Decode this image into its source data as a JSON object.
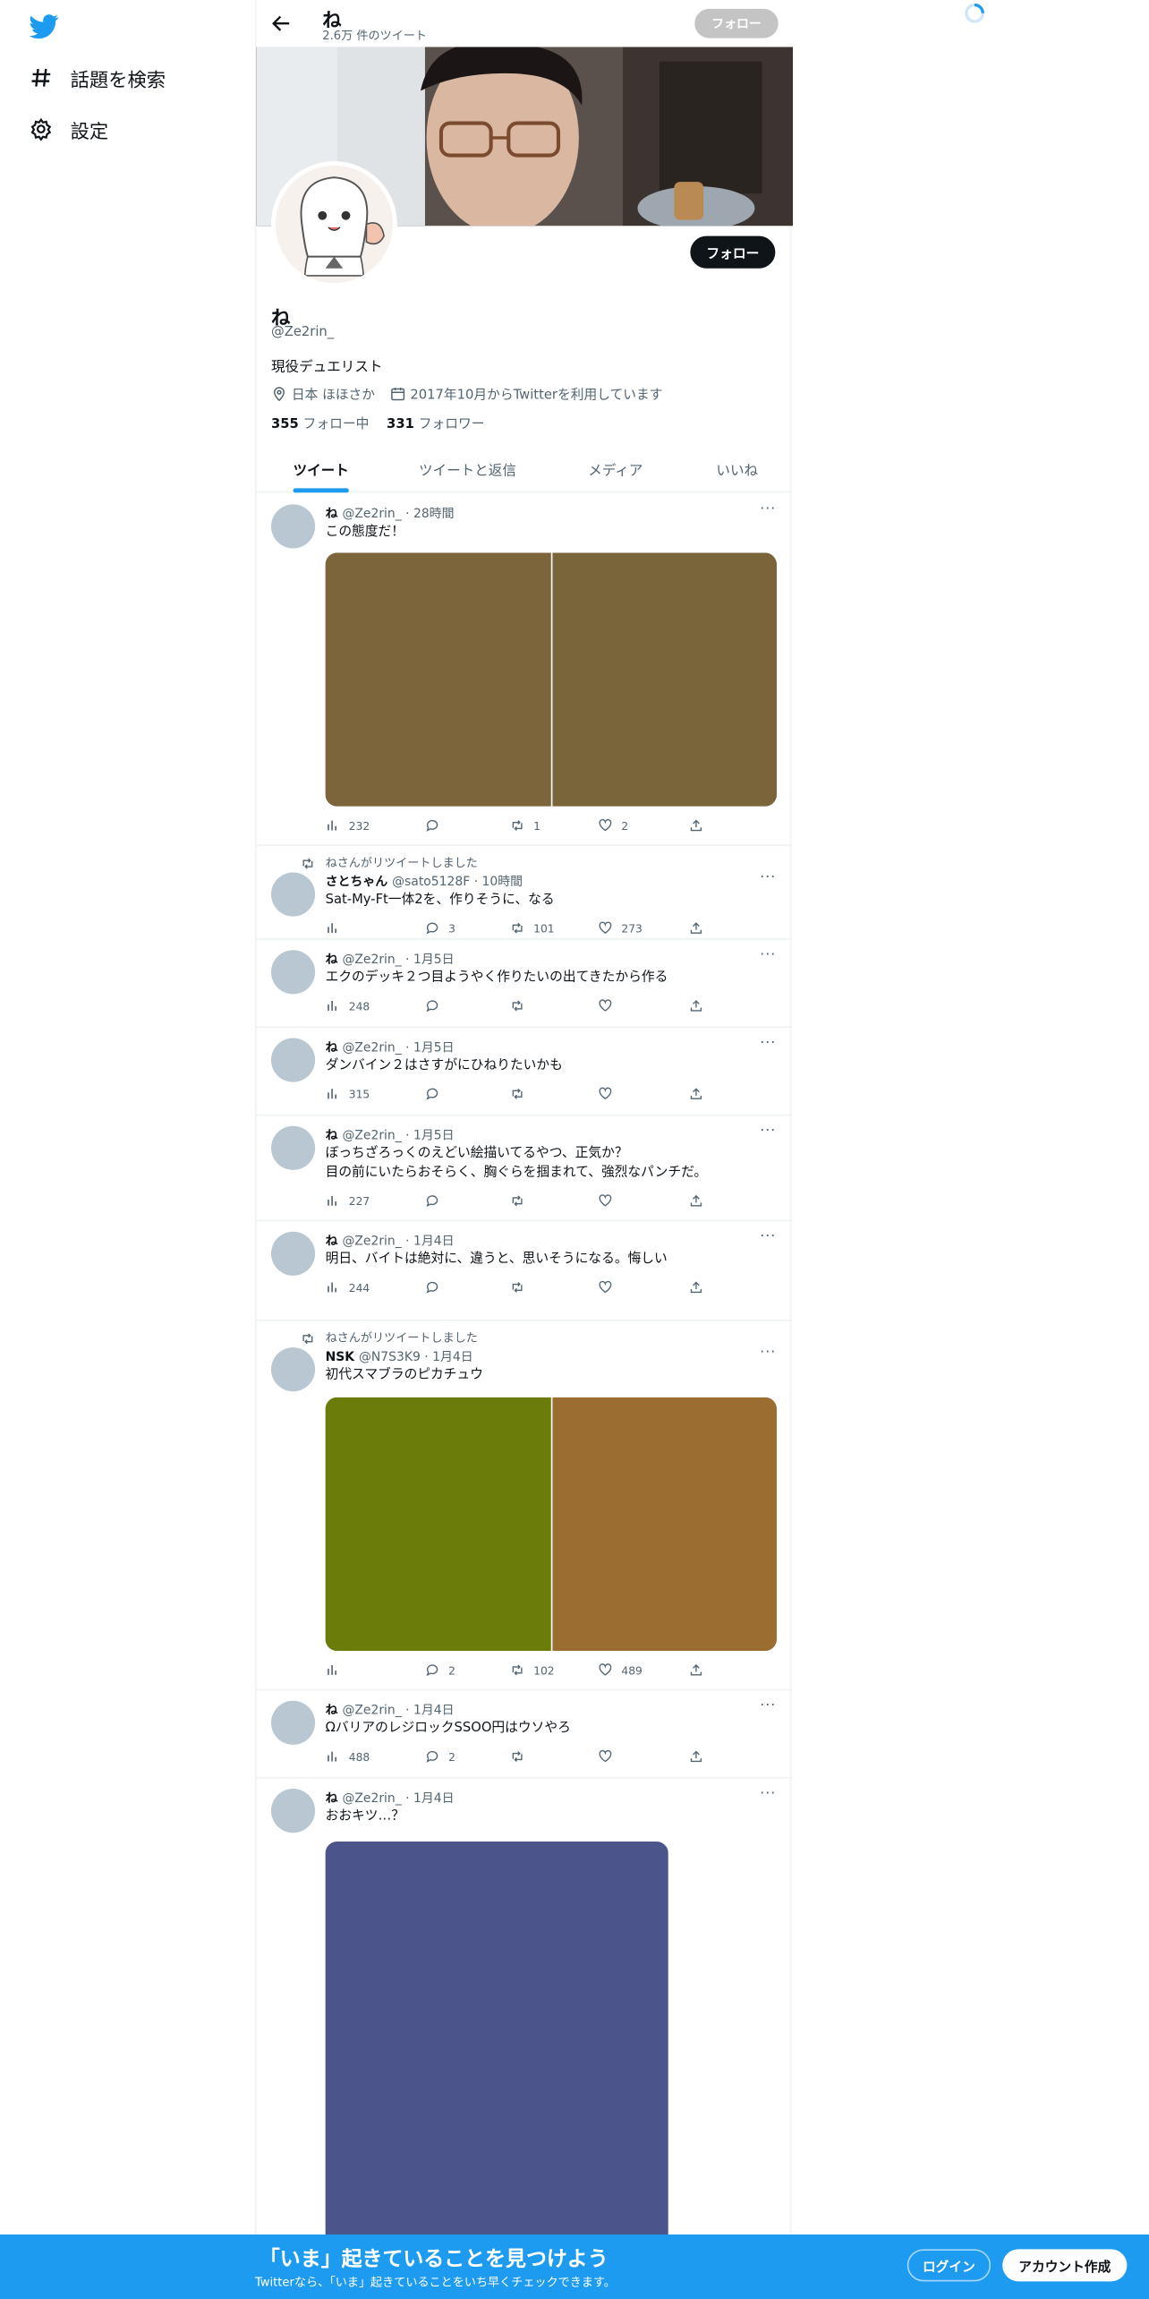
{
  "nav": {
    "items": [
      {
        "label": "話題を検索",
        "icon": "hashtag-icon"
      },
      {
        "label": "設定",
        "icon": "gear-icon"
      }
    ]
  },
  "header": {
    "name": "ね",
    "tweet_count": "2.6万 件のツイート",
    "follow_label": "フォロー"
  },
  "profile": {
    "follow_label": "フォロー",
    "name": "ね",
    "handle": "@Ze2rin_",
    "bio": "現役デュエリスト",
    "location": "日本 ほほさか",
    "joined": "2017年10月からTwitterを利用しています",
    "following_count": "355",
    "following_label": "フォロー中",
    "followers_count": "331",
    "followers_label": "フォロワー"
  },
  "tabs": [
    "ツイート",
    "ツイートと返信",
    "メディア",
    "いいね"
  ],
  "tweets": [
    {
      "name": "ね",
      "meta": "@Ze2rin_ · 28時間",
      "text": "この態度だ！",
      "views": "232",
      "replies": "",
      "retweets": "1",
      "likes": "2",
      "media_colors": [
        "#7d653b",
        "#7a653b"
      ]
    },
    {
      "retweeted_by": "ねさんがリツイートしました",
      "name": "さとちゃん",
      "meta": "@sato5128F · 10時間",
      "text": "Sat-My-Ft一体2を、作りそうに、なる",
      "views": "",
      "replies": "3",
      "retweets": "101",
      "likes": "273"
    },
    {
      "name": "ね",
      "meta": "@Ze2rin_ · 1月5日",
      "text": "エクのデッキ２つ目ようやく作りたいの出てきたから作る",
      "views": "248",
      "replies": "",
      "retweets": "",
      "likes": ""
    },
    {
      "name": "ね",
      "meta": "@Ze2rin_ · 1月5日",
      "text": "ダンバイン２はさすがにひねりたいかも",
      "views": "315",
      "replies": "",
      "retweets": "",
      "likes": ""
    },
    {
      "name": "ね",
      "meta": "@Ze2rin_ · 1月5日",
      "text": "ぼっちざろっくのえどい絵描いてるやつ、正気か？\n目の前にいたらおそらく、胸ぐらを掴まれて、強烈なパンチだ。",
      "views": "227",
      "replies": "",
      "retweets": "",
      "likes": ""
    },
    {
      "name": "ね",
      "meta": "@Ze2rin_ · 1月4日",
      "text": "明日、バイトは絶対に、違うと、思いそうになる。悔しい",
      "views": "244",
      "replies": "",
      "retweets": "",
      "likes": ""
    },
    {
      "retweeted_by": "ねさんがリツイートしました",
      "name": "NSK",
      "meta": "@N7S3K9 · 1月4日",
      "text": "初代スマブラのピカチュウ",
      "views": "",
      "replies": "2",
      "retweets": "102",
      "likes": "489",
      "media_colors": [
        "#6b7c0b",
        "#9b6d31"
      ]
    },
    {
      "name": "ね",
      "meta": "@Ze2rin_ · 1月4日",
      "text": "ΩバリアのレジロックSSOO円はウソやろ",
      "views": "488",
      "replies": "2",
      "retweets": "",
      "likes": ""
    },
    {
      "name": "ね",
      "meta": "@Ze2rin_ · 1月4日",
      "text": "おおキツ…？",
      "media_colors": [
        "#4b548b"
      ]
    }
  ],
  "bottom_bar": {
    "title": "「いま」起きていることを見つけよう",
    "subtitle": "Twitterなら、「いま」起きていることをいち早くチェックできます。",
    "login_label": "ログイン",
    "signup_label": "アカウント作成"
  },
  "colors": {
    "accent": "#1d9bf0",
    "text": "#0f1419",
    "muted": "#536471"
  }
}
